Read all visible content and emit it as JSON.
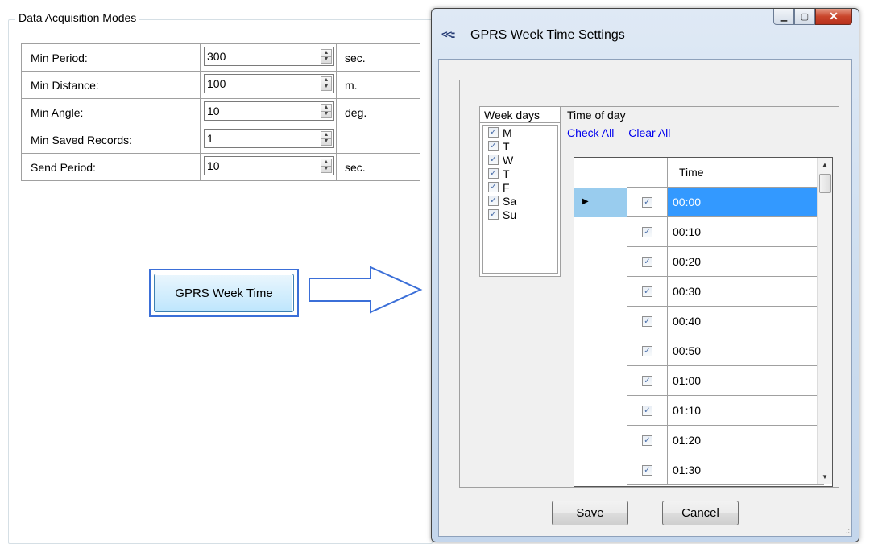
{
  "group": {
    "title": "Data Acquisition Modes"
  },
  "params": [
    {
      "label": "Min Period:",
      "value": "300",
      "unit": "sec."
    },
    {
      "label": "Min Distance:",
      "value": "100",
      "unit": "m."
    },
    {
      "label": "Min Angle:",
      "value": "10",
      "unit": "deg."
    },
    {
      "label": "Min Saved Records:",
      "value": "1",
      "unit": ""
    },
    {
      "label": "Send Period:",
      "value": "10",
      "unit": "sec."
    }
  ],
  "gprs_button": {
    "label": "GPRS Week Time"
  },
  "dialog": {
    "title": "GPRS Week Time Settings",
    "weekdays_header": "Week days",
    "weekdays": [
      "M",
      "T",
      "W",
      "T",
      "F",
      "Sa",
      "Su"
    ],
    "time_of_day_header": "Time of day",
    "check_all": "Check All",
    "clear_all": "Clear All",
    "grid_header_time": "Time",
    "times": [
      "00:00",
      "00:10",
      "00:20",
      "00:30",
      "00:40",
      "00:50",
      "01:00",
      "01:10",
      "01:20",
      "01:30"
    ],
    "save_label": "Save",
    "cancel_label": "Cancel"
  },
  "colors": {
    "selection": "#3399ff",
    "highlight_border": "#3b6fd8",
    "link": "#0000ee"
  }
}
